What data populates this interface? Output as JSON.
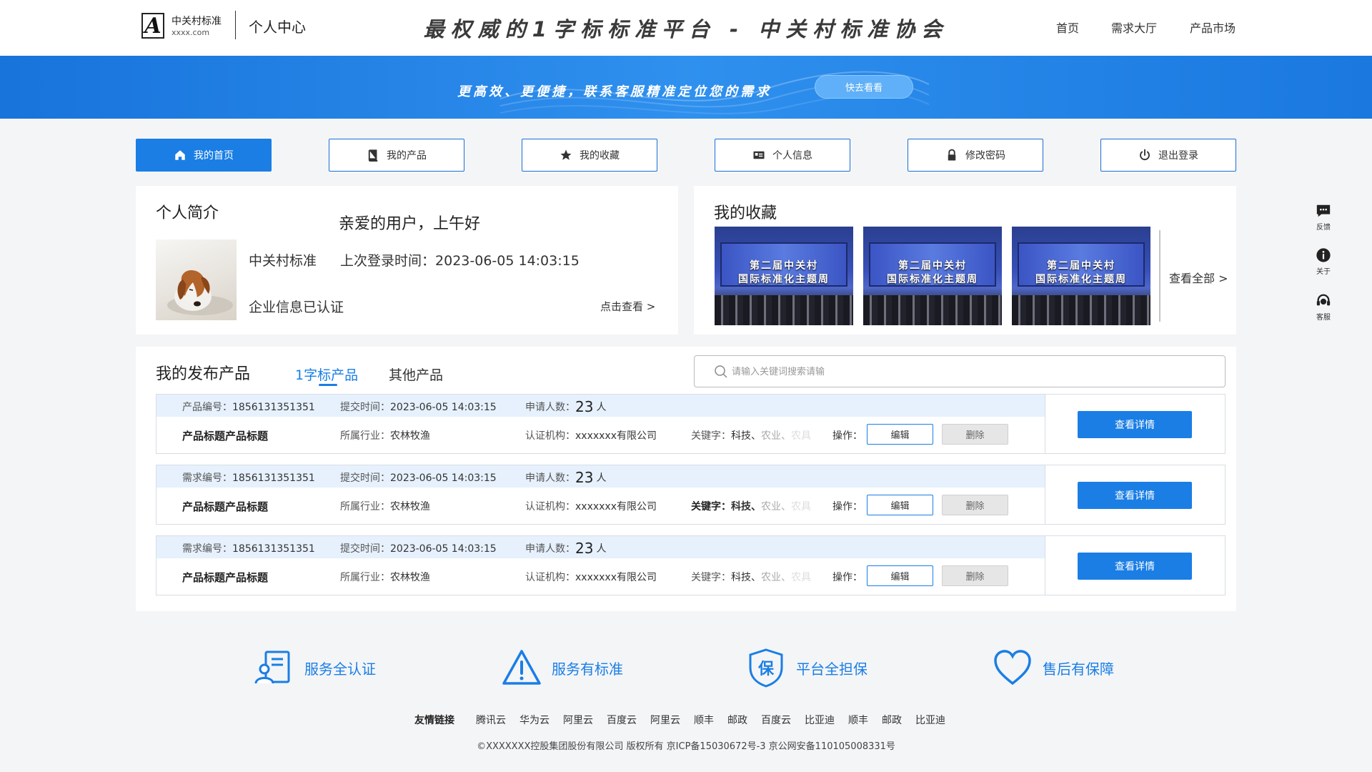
{
  "header": {
    "logo_name": "中关村标准",
    "logo_domain": "xxxx.com",
    "title": "个人中心",
    "slogan": "最权威的1字标标准平台 - 中关村标准协会",
    "nav": [
      "首页",
      "需求大厅",
      "产品市场"
    ]
  },
  "banner": {
    "text": "更高效、更便捷，联系客服精准定位您的需求",
    "button": "快去看看"
  },
  "tabs": [
    {
      "label": "我的首页",
      "icon": "home-icon",
      "active": true
    },
    {
      "label": "我的产品",
      "icon": "book-icon",
      "active": false
    },
    {
      "label": "我的收藏",
      "icon": "star-icon",
      "active": false
    },
    {
      "label": "个人信息",
      "icon": "id-card-icon",
      "active": false
    },
    {
      "label": "修改密码",
      "icon": "lock-icon",
      "active": false
    },
    {
      "label": "退出登录",
      "icon": "power-icon",
      "active": false
    }
  ],
  "profile": {
    "title": "个人简介",
    "greeting": "亲爱的用户，上午好",
    "company": "中关村标准",
    "last_login_label": "上次登录时间：",
    "last_login_value": "2023-06-05  14:03:15",
    "status": "企业信息已认证",
    "link": "点击查看 >"
  },
  "favorites": {
    "title": "我的收藏",
    "items": [
      {
        "caption_line1": "第二届中关村",
        "caption_line2": "国际标准化主题周"
      },
      {
        "caption_line1": "第二届中关村",
        "caption_line2": "国际标准化主题周"
      },
      {
        "caption_line1": "第二届中关村",
        "caption_line2": "国际标准化主题周"
      }
    ],
    "view_all": "查看全部 >"
  },
  "products": {
    "title": "我的发布产品",
    "tabs": [
      "1字标产品",
      "其他产品"
    ],
    "search_placeholder": "请输入关键词搜索请输",
    "rows": [
      {
        "id_label": "产品编号：",
        "id_value": "1856131351351",
        "submit_label": "提交时间：",
        "submit_value": "2023-06-05 14:03:15",
        "applicants_label": "申请人数：",
        "applicants_value": "23",
        "applicants_unit": "人",
        "name": "产品标题产品标题",
        "industry_label": "所属行业：",
        "industry_value": "农林牧渔",
        "org_label": "认证机构：",
        "org_value": "xxxxxxx有限公司",
        "keyword_label": "关键字：",
        "keyword_1": "科技、",
        "keyword_2": "农业、",
        "keyword_3": "农具",
        "op_label": "操作：",
        "edit": "编辑",
        "delete": "删除",
        "detail": "查看详情"
      },
      {
        "id_label": "需求编号：",
        "id_value": "1856131351351",
        "submit_label": "提交时间：",
        "submit_value": "2023-06-05 14:03:15",
        "applicants_label": "申请人数：",
        "applicants_value": "23",
        "applicants_unit": "人",
        "name": "产品标题产品标题",
        "industry_label": "所属行业：",
        "industry_value": "农林牧渔",
        "org_label": "认证机构：",
        "org_value": "xxxxxxx有限公司",
        "keyword_label": "关键字：",
        "keyword_1": "科技、",
        "keyword_2": "农业、",
        "keyword_3": "农具",
        "op_label": "操作：",
        "edit": "编辑",
        "delete": "删除",
        "detail": "查看详情"
      },
      {
        "id_label": "需求编号：",
        "id_value": "1856131351351",
        "submit_label": "提交时间：",
        "submit_value": "2023-06-05 14:03:15",
        "applicants_label": "申请人数：",
        "applicants_value": "23",
        "applicants_unit": "人",
        "name": "产品标题产品标题",
        "industry_label": "所属行业：",
        "industry_value": "农林牧渔",
        "org_label": "认证机构：",
        "org_value": "xxxxxxx有限公司",
        "keyword_label": "关键字：",
        "keyword_1": "科技、",
        "keyword_2": "农业、",
        "keyword_3": "农具",
        "op_label": "操作：",
        "edit": "编辑",
        "delete": "删除",
        "detail": "查看详情"
      }
    ]
  },
  "features": [
    {
      "label": "服务全认证",
      "icon": "certificate-user-icon"
    },
    {
      "label": "服务有标准",
      "icon": "warning-triangle-icon"
    },
    {
      "label": "平台全担保",
      "icon": "shield-guarantee-icon"
    },
    {
      "label": "售后有保障",
      "icon": "heart-icon"
    }
  ],
  "footer": {
    "links_label": "友情链接",
    "links": [
      "腾讯云",
      "华为云",
      "阿里云",
      "百度云",
      "阿里云",
      "顺丰",
      "邮政",
      "百度云",
      "比亚迪",
      "顺丰",
      "邮政",
      "比亚迪"
    ],
    "copyright": "©XXXXXXX控股集团股份有限公司 版权所有 京ICP备15030672号-3  京公网安备110105008331号"
  },
  "side": [
    {
      "label": "反馈",
      "icon": "chat-icon"
    },
    {
      "label": "关于",
      "icon": "info-icon"
    },
    {
      "label": "客服",
      "icon": "headset-icon"
    }
  ],
  "colors": {
    "primary": "#1a7ee5",
    "banner": "#1f85e6",
    "row_header": "#e6f1fd",
    "page_bg": "#f4f5f7"
  }
}
